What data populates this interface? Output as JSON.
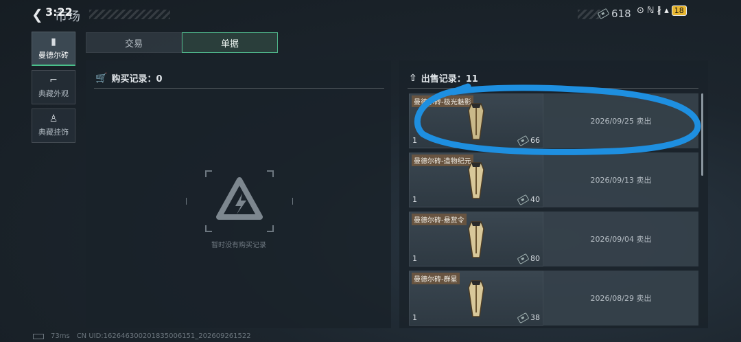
{
  "status_bar": {
    "time": "3:22",
    "icons": "⊙ ℕ ∦ ▴",
    "battery": "18"
  },
  "header": {
    "title": "市场",
    "currency_value": "618"
  },
  "nav": {
    "items": [
      {
        "label": "曼德尔砖",
        "icon": "brick-icon",
        "glyph": "▮",
        "active": true
      },
      {
        "label": "典藏外观",
        "icon": "gun-icon",
        "glyph": "⌐",
        "active": false
      },
      {
        "label": "典藏挂饰",
        "icon": "charm-icon",
        "glyph": "♙",
        "active": false
      }
    ]
  },
  "tabs": [
    {
      "label": "交易",
      "active": false
    },
    {
      "label": "单据",
      "active": true
    }
  ],
  "purchase": {
    "title": "购买记录：0",
    "empty_text": "暂时没有购买记录"
  },
  "sales": {
    "title": "出售记录：11",
    "rows": [
      {
        "name": "曼德尔砖-极光魅影",
        "qty": "1",
        "price": "66",
        "info": "2026/09/25 卖出"
      },
      {
        "name": "曼德尔砖-造物纪元",
        "qty": "1",
        "price": "40",
        "info": "2026/09/13 卖出"
      },
      {
        "name": "曼德尔砖-悬赏令",
        "qty": "1",
        "price": "80",
        "info": "2026/09/04 卖出"
      },
      {
        "name": "曼德尔砖-群星",
        "qty": "1",
        "price": "38",
        "info": "2026/08/29 卖出"
      }
    ]
  },
  "footer": {
    "ping": "73ms",
    "uid": "CN UID:16264630020183500​6151_202609261522"
  },
  "colors": {
    "accent": "#49c08a",
    "annotation": "#1e8fe0"
  }
}
